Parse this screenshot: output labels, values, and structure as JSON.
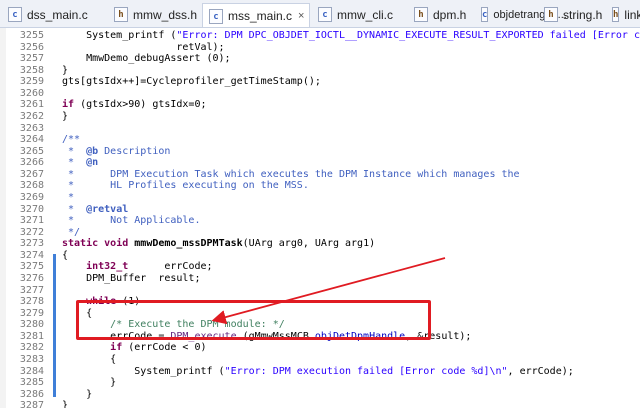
{
  "tabs": [
    {
      "label": "dss_main.c",
      "icon": "c-file-icon",
      "active": false
    },
    {
      "label": "mmw_dss.h",
      "icon": "h-file-icon",
      "active": false
    },
    {
      "label": "mss_main.c",
      "icon": "c-file-icon",
      "active": true,
      "close": "×"
    },
    {
      "label": "mmw_cli.c",
      "icon": "c-file-icon",
      "active": false
    },
    {
      "label": "dpm.h",
      "icon": "h-file-icon",
      "active": false
    },
    {
      "label": "objdetrangeh...",
      "icon": "c-file-icon",
      "active": false
    },
    {
      "label": "string.h",
      "icon": "h-file-icon",
      "active": false
    },
    {
      "label": "linka",
      "icon": "h-file-icon",
      "active": false
    }
  ],
  "lines": [
    {
      "num": "3255",
      "code": "    System_printf (\"Error: DPM DPC_OBJDET_IOCTL__DYNAMIC_EXECUTE_RESULT_EXPORTED failed [Error code %d]\\n\","
    },
    {
      "num": "3256",
      "code": "                   retVal);"
    },
    {
      "num": "3257",
      "code": "    MmwDemo_debugAssert (0);"
    },
    {
      "num": "3258",
      "code": "}"
    },
    {
      "num": "3259",
      "code": "gts[gtsIdx++]=Cycleprofiler_getTimeStamp();"
    },
    {
      "num": "3260",
      "code": ""
    },
    {
      "num": "3261",
      "code": "if (gtsIdx>90) gtsIdx=0;"
    },
    {
      "num": "3262",
      "code": "}"
    },
    {
      "num": "3263",
      "code": ""
    },
    {
      "num": "3264",
      "code": "/**"
    },
    {
      "num": "3265",
      "code": " *  @b Description"
    },
    {
      "num": "3266",
      "code": " *  @n"
    },
    {
      "num": "3267",
      "code": " *      DPM Execution Task which executes the DPM Instance which manages the"
    },
    {
      "num": "3268",
      "code": " *      HL Profiles executing on the MSS."
    },
    {
      "num": "3269",
      "code": " *"
    },
    {
      "num": "3270",
      "code": " *  @retval"
    },
    {
      "num": "3271",
      "code": " *      Not Applicable."
    },
    {
      "num": "3272",
      "code": " */"
    },
    {
      "num": "3273",
      "code": "static void mmwDemo_mssDPMTask(UArg arg0, UArg arg1)"
    },
    {
      "num": "3274",
      "code": "{"
    },
    {
      "num": "3275",
      "code": "    int32_t      errCode;"
    },
    {
      "num": "3276",
      "code": "    DPM_Buffer  result;"
    },
    {
      "num": "3277",
      "code": ""
    },
    {
      "num": "3278",
      "code": "    while (1)"
    },
    {
      "num": "3279",
      "code": "    {"
    },
    {
      "num": "3280",
      "code": "        /* Execute the DPM module: */"
    },
    {
      "num": "3281",
      "code": "        errCode = DPM_execute (gMmwMssMCB.objDetDpmHandle, &result);"
    },
    {
      "num": "3282",
      "code": "        if (errCode < 0)"
    },
    {
      "num": "3283",
      "code": "        {"
    },
    {
      "num": "3284",
      "code": "            System_printf (\"Error: DPM execution failed [Error code %d]\\n\", errCode);"
    },
    {
      "num": "3285",
      "code": "        }"
    },
    {
      "num": "3286",
      "code": "    }"
    },
    {
      "num": "3287",
      "code": "}"
    }
  ]
}
